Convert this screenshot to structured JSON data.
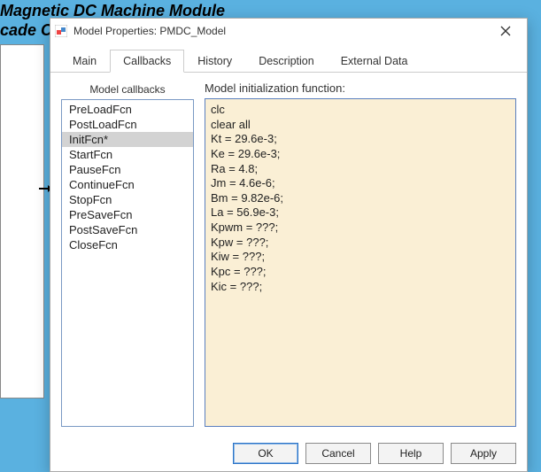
{
  "background": {
    "title_line1": "Magnetic DC Machine Module",
    "title_line2": "cade C"
  },
  "dialog": {
    "title": "Model Properties: PMDC_Model",
    "tabs": {
      "main": "Main",
      "callbacks": "Callbacks",
      "history": "History",
      "description": "Description",
      "external": "External Data"
    },
    "left_header": "Model callbacks",
    "callbacks": [
      "PreLoadFcn",
      "PostLoadFcn",
      "InitFcn*",
      "StartFcn",
      "PauseFcn",
      "ContinueFcn",
      "StopFcn",
      "PreSaveFcn",
      "PostSaveFcn",
      "CloseFcn"
    ],
    "selected_index": 2,
    "editor_label": "Model initialization function:",
    "editor_content": "clc\nclear all\nKt = 29.6e-3;\nKe = 29.6e-3;\nRa = 4.8;\nJm = 4.6e-6;\nBm = 9.82e-6;\nLa = 56.9e-3;\nKpwm = ???;\nKpw = ???;\nKiw = ???;\nKpc = ???;\nKic = ???;",
    "buttons": {
      "ok": "OK",
      "cancel": "Cancel",
      "help": "Help",
      "apply": "Apply"
    }
  }
}
